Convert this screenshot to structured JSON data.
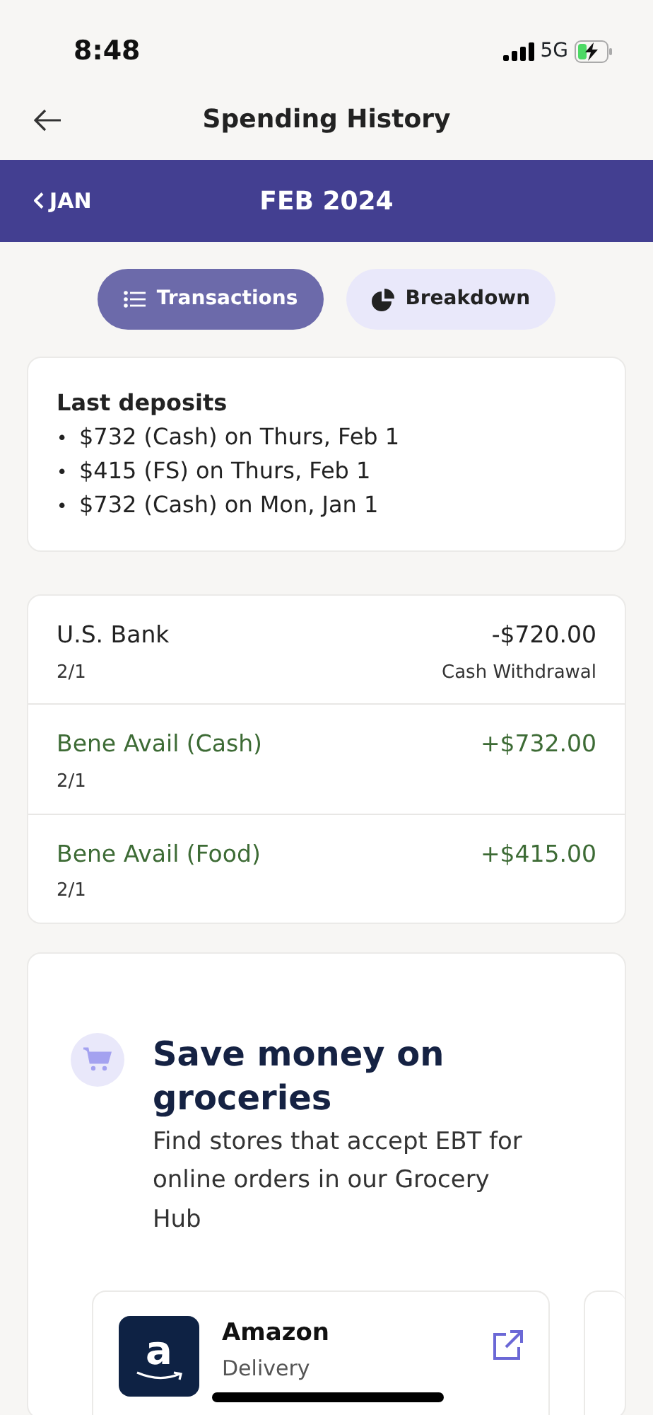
{
  "status_bar": {
    "time": "8:48",
    "network": "5G",
    "battery_charging": true
  },
  "header": {
    "title": "Spending History"
  },
  "month_bar": {
    "previous": "JAN",
    "current": "FEB 2024"
  },
  "tabs": [
    {
      "label": "Transactions",
      "kind": "list",
      "selected": true
    },
    {
      "label": "Breakdown",
      "kind": "pie",
      "selected": false
    }
  ],
  "deposits": {
    "title": "Last deposits",
    "items": [
      {
        "marker": "•",
        "text": "$732 (Cash) on Thurs, Feb 1"
      },
      {
        "marker": "•",
        "text": "$415 (FS) on Thurs, Feb 1"
      },
      {
        "marker": "•",
        "text": "$732 (Cash) on Mon, Jan 1"
      }
    ]
  },
  "transactions": [
    {
      "name": "U.S. Bank",
      "date": "2/1",
      "amount": "-$720.00",
      "note": "Cash Withdrawal",
      "kind": "debit"
    },
    {
      "name": "Bene Avail (Cash)",
      "date": "2/1",
      "amount": "+$732.00",
      "kind": "credit"
    },
    {
      "name": "Bene Avail (Food)",
      "date": "2/1",
      "amount": "+$415.00",
      "kind": "credit"
    }
  ],
  "promo": {
    "title": "Save money on groceries",
    "text": "Find stores that accept EBT for online orders in our Grocery Hub",
    "stores": [
      {
        "logo_text": "a",
        "name": "Amazon",
        "subtitle": "Delivery"
      }
    ]
  }
}
